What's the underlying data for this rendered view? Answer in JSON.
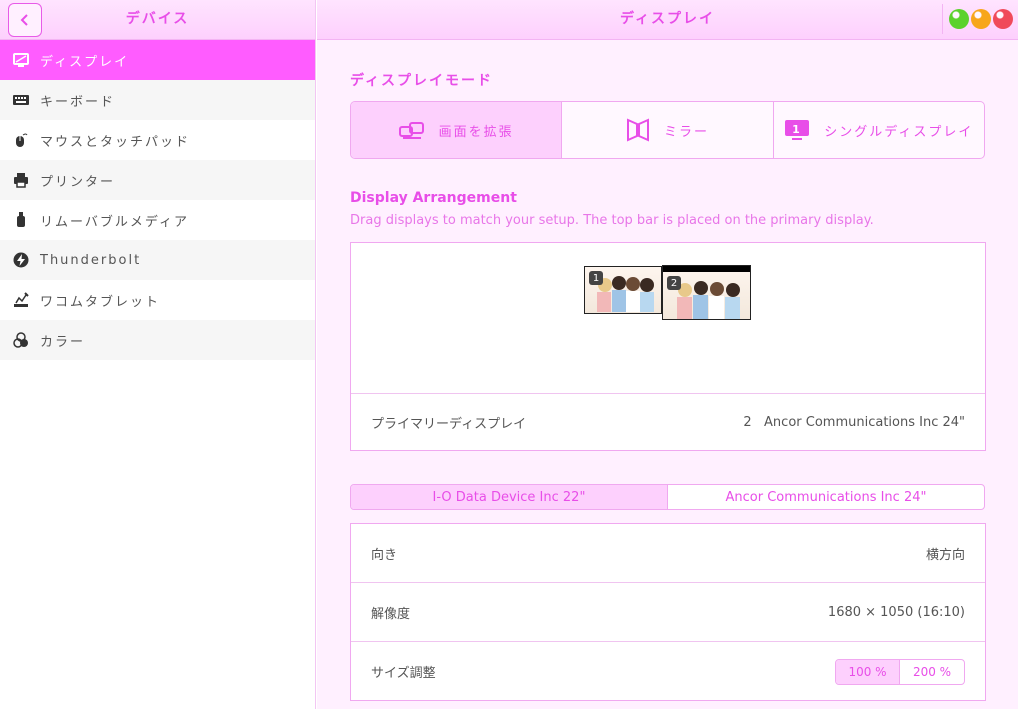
{
  "sidebar": {
    "title": "デバイス",
    "items": [
      {
        "label": "ディスプレイ",
        "icon": "display-icon",
        "active": true
      },
      {
        "label": "キーボード",
        "icon": "keyboard-icon"
      },
      {
        "label": "マウスとタッチパッド",
        "icon": "mouse-icon"
      },
      {
        "label": "プリンター",
        "icon": "printer-icon"
      },
      {
        "label": "リムーバブルメディア",
        "icon": "usb-drive-icon"
      },
      {
        "label": "Thunderbolt",
        "icon": "thunderbolt-icon"
      },
      {
        "label": "ワコムタブレット",
        "icon": "tablet-icon"
      },
      {
        "label": "カラー",
        "icon": "color-icon"
      }
    ]
  },
  "header": {
    "title": "ディスプレイ"
  },
  "window_controls": {
    "colors": [
      "#5bd22c",
      "#f7a61b",
      "#f04a5a"
    ]
  },
  "display_mode": {
    "title": "ディスプレイモード",
    "options": [
      {
        "label": "画面を拡張",
        "icon": "join-displays-icon",
        "active": true
      },
      {
        "label": "ミラー",
        "icon": "mirror-icon"
      },
      {
        "label": "シングルディスプレイ",
        "icon": "single-display-icon"
      }
    ]
  },
  "arrangement": {
    "title": "Display Arrangement",
    "description": "Drag displays to match your setup. The top bar is placed on the primary display.",
    "monitors": [
      {
        "number": "1"
      },
      {
        "number": "2"
      }
    ]
  },
  "primary": {
    "label": "プライマリーディスプレイ",
    "value": "2   Ancor Communications Inc 24\""
  },
  "display_tabs": [
    {
      "label": "I-O Data Device Inc 22\"",
      "active": true
    },
    {
      "label": "Ancor Communications Inc 24\""
    }
  ],
  "settings": {
    "orientation": {
      "label": "向き",
      "value": "横方向"
    },
    "resolution": {
      "label": "解像度",
      "value": "1680 × 1050 (16:10)"
    },
    "scale": {
      "label": "サイズ調整",
      "options": [
        "100 %",
        "200 %"
      ]
    }
  },
  "colors": {
    "accent": "#ff5cff",
    "accent_text": "#e84ee8",
    "bg": "#fff0ff"
  }
}
